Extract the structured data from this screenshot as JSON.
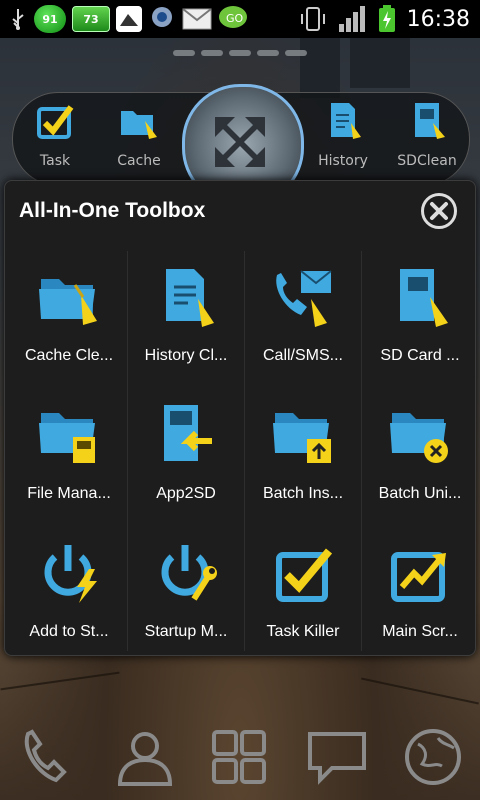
{
  "status_bar": {
    "badge_circle": "91",
    "badge_battery": "73",
    "time": "16:38"
  },
  "top_dock": {
    "items": [
      {
        "label": "Task"
      },
      {
        "label": "Cache"
      },
      {
        "label": "History"
      },
      {
        "label": "SDClean"
      }
    ]
  },
  "dialog": {
    "title": "All-In-One Toolbox",
    "tools": [
      {
        "label": "Cache Cle...",
        "icon": "folder-broom-icon"
      },
      {
        "label": "History Cl...",
        "icon": "document-broom-icon"
      },
      {
        "label": "Call/SMS...",
        "icon": "phone-mail-broom-icon"
      },
      {
        "label": "SD Card ...",
        "icon": "sdcard-broom-icon"
      },
      {
        "label": "File Mana...",
        "icon": "folder-sdcard-icon"
      },
      {
        "label": "App2SD",
        "icon": "app-to-sd-icon"
      },
      {
        "label": "Batch Ins...",
        "icon": "folder-install-icon"
      },
      {
        "label": "Batch Uni...",
        "icon": "folder-uninstall-icon"
      },
      {
        "label": "Add to St...",
        "icon": "power-bolt-icon"
      },
      {
        "label": "Startup M...",
        "icon": "power-wrench-icon"
      },
      {
        "label": "Task Killer",
        "icon": "checkbox-icon"
      },
      {
        "label": "Main Scr...",
        "icon": "chart-up-icon"
      }
    ]
  },
  "colors": {
    "icon_blue": "#3fa9e0",
    "icon_yellow": "#f5d21a",
    "dialog_bg": "#1d1d1d"
  }
}
